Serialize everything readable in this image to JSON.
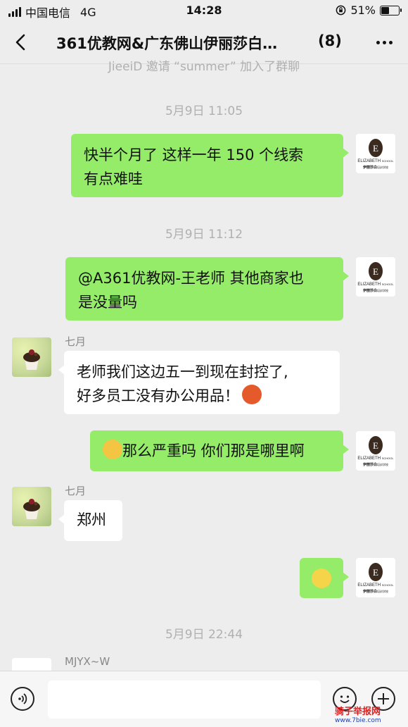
{
  "status_bar": {
    "carrier": "中国电信",
    "network": "4G",
    "time": "14:28",
    "battery": "51%",
    "battery_level": 0.51
  },
  "header": {
    "title": "361优教网&广东佛山伊丽莎白…",
    "member_count": "(8)"
  },
  "system_message": "JieeiD  邀请 “summer” 加入了群聊",
  "messages": [
    {
      "type": "time",
      "text": "5月9日 11:05"
    },
    {
      "type": "sent",
      "text_line1": "快半个月了   这样一年 150 个线索",
      "text_line2": "有点难哇"
    },
    {
      "type": "time",
      "text": "5月9日 11:12"
    },
    {
      "type": "sent",
      "text_line1": "@A361优教网-王老师 其他商家也",
      "text_line2": "是没量吗"
    },
    {
      "type": "received",
      "sender": "七月",
      "text_line1": "老师我们这边五一到现在封控了,",
      "text_line2": "好多员工没有办公用品！"
    },
    {
      "type": "sent",
      "text": "那么严重吗 你们那是哪里啊"
    },
    {
      "type": "received",
      "sender": "七月",
      "text": "郑州"
    },
    {
      "type": "sent_emoji"
    },
    {
      "type": "time",
      "text": "5月9日 22:44"
    },
    {
      "type": "received",
      "sender": "MJYX~W"
    }
  ],
  "logo": {
    "letter": "E",
    "name": "ELIZABETH",
    "school": "SCHOOL",
    "cn": "伊丽莎白",
    "cn_sub": "培训学校"
  },
  "watermark": {
    "text": "骑子举报网",
    "url": "www.7bie.com"
  },
  "colors": {
    "sent_bubble": "#95ec69",
    "received_bubble": "#ffffff",
    "background": "#ededed"
  }
}
